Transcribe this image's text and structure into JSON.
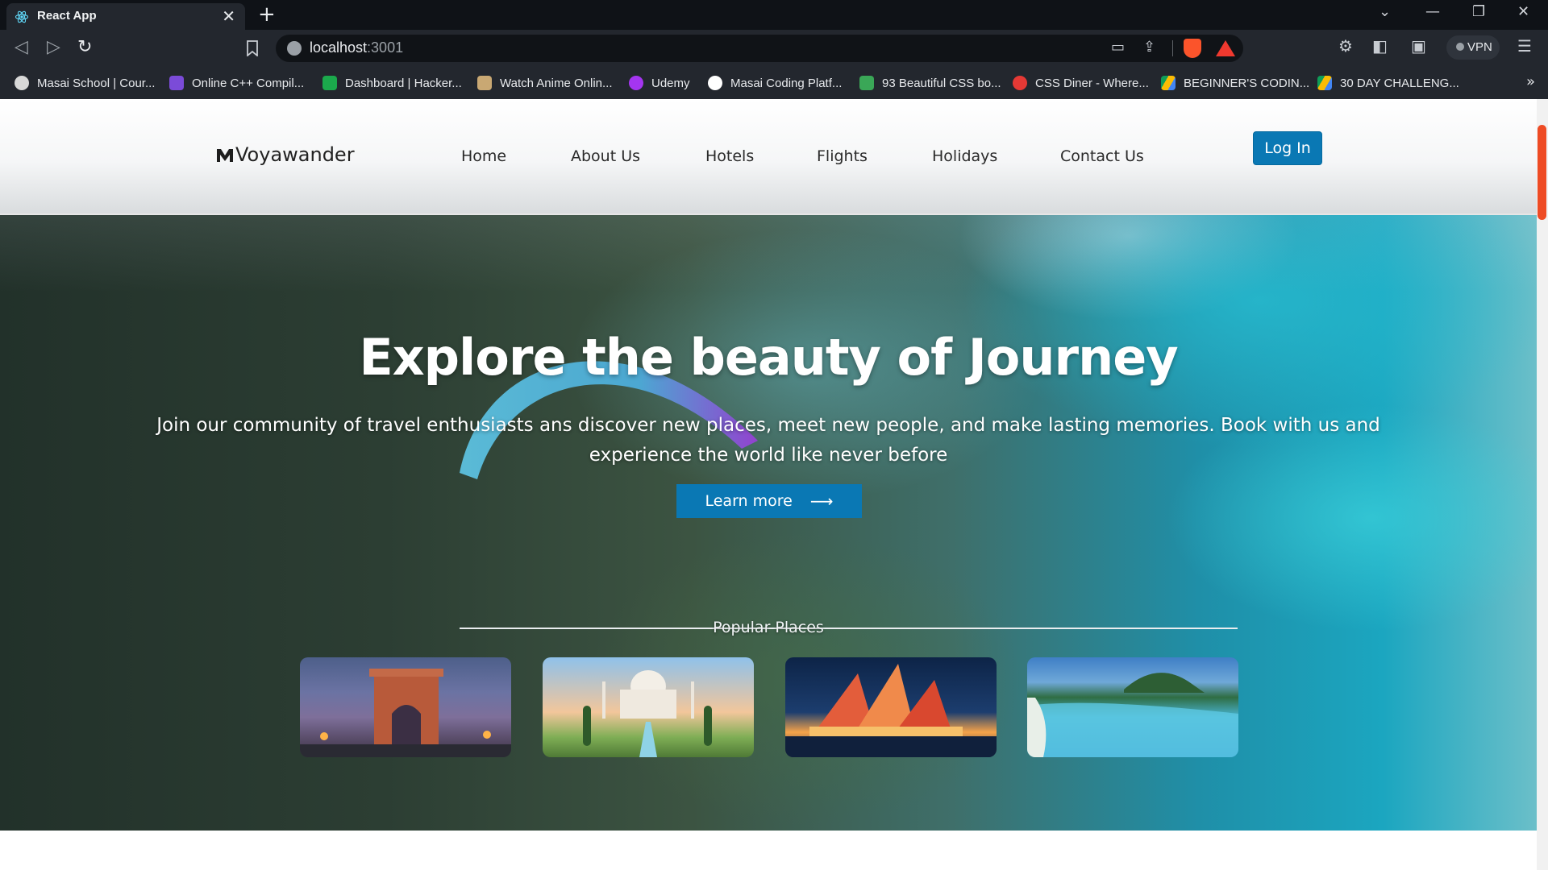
{
  "browser": {
    "tab_title": "React App",
    "url_host": "localhost",
    "url_port": ":3001",
    "vpn_label": "VPN",
    "bookmarks": [
      {
        "label": "Masai School | Cour...",
        "icon": "globe-icon",
        "color": "#d8d8d8"
      },
      {
        "label": "Online C++ Compil...",
        "icon": "bolt-icon",
        "color": "#7b4bd8"
      },
      {
        "label": "Dashboard | Hacker...",
        "icon": "hackerrank-icon",
        "color": "#1ba94c"
      },
      {
        "label": "Watch Anime Onlin...",
        "icon": "anime-icon",
        "color": "#c9a873"
      },
      {
        "label": "Udemy",
        "icon": "udemy-icon",
        "color": "#a435f0"
      },
      {
        "label": "Masai Coding Platf...",
        "icon": "masai-icon",
        "color": "#ffffff"
      },
      {
        "label": "93 Beautiful CSS bo...",
        "icon": "css-icon",
        "color": "#3aa757"
      },
      {
        "label": "CSS Diner - Where...",
        "icon": "diner-icon",
        "color": "#e53935"
      },
      {
        "label": "BEGINNER'S CODIN...",
        "icon": "drive-icon",
        "color": "#fbbc04"
      },
      {
        "label": "30 DAY CHALLENG...",
        "icon": "drive-icon",
        "color": "#fbbc04"
      }
    ]
  },
  "site": {
    "logo_text": "Voyawander",
    "nav": [
      "Home",
      "About Us",
      "Hotels",
      "Flights",
      "Holidays",
      "Contact Us"
    ],
    "login_label": "Log In",
    "hero_title": "Explore the beauty of Journey",
    "hero_subtitle": "Join our community of travel enthusiasts ans discover new places, meet new people, and make lasting memories. Book with us and experience the world like never before",
    "learn_more_label": "Learn more",
    "learn_more_arrow": "⟶",
    "popular_heading": "Popular Places",
    "places": [
      {
        "name": "india-gate-image"
      },
      {
        "name": "taj-mahal-image"
      },
      {
        "name": "sydney-opera-house-image"
      },
      {
        "name": "tropical-island-image"
      }
    ]
  },
  "colors": {
    "brand_blue": "#0a78b4",
    "scrollbar_accent": "#ee4b24",
    "chrome_dark": "#23272e"
  }
}
